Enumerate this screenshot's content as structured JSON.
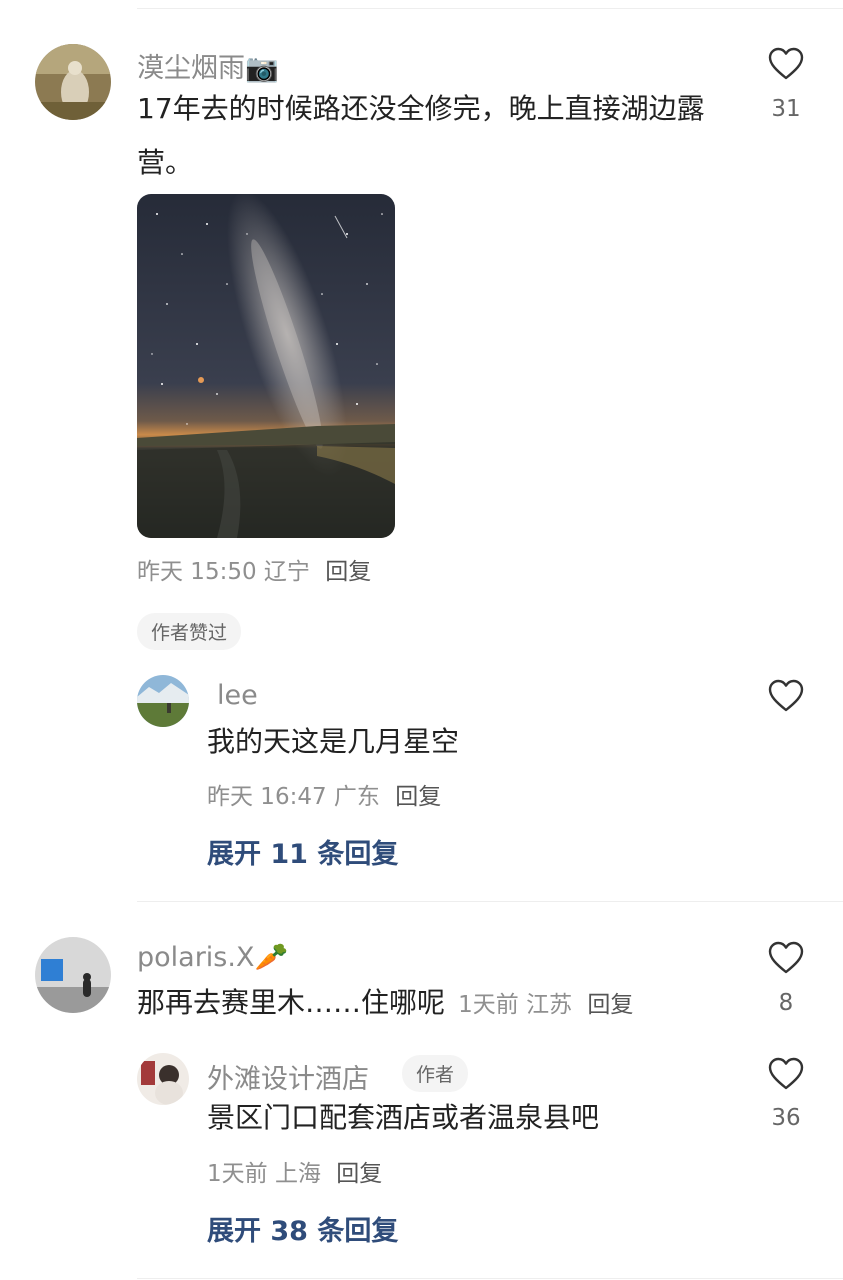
{
  "comments": [
    {
      "username": "漠尘烟雨📷",
      "text": "17年去的时候路还没全修完，晚上直接湖边露营。",
      "time": "昨天 15:50",
      "location": "辽宁",
      "reply_label": "回复",
      "likes": "31",
      "badge": "作者赞过",
      "reply": {
        "username": "lee",
        "text": "我的天这是几月星空",
        "time": "昨天 16:47",
        "location": "广东",
        "reply_label": "回复"
      },
      "expand_label": "展开 11 条回复"
    },
    {
      "username": "polaris.X🥕",
      "text": "那再去赛里木……住哪呢",
      "time": "1天前",
      "location": "江苏",
      "reply_label": "回复",
      "likes": "8",
      "reply": {
        "username": "外滩设计酒店",
        "author_tag": "作者",
        "text": "景区门口配套酒店或者温泉县吧",
        "time": "1天前",
        "location": "上海",
        "reply_label": "回复",
        "likes": "36"
      },
      "expand_label": "展开 38 条回复"
    }
  ],
  "colors": {
    "link": "#2f4c7a",
    "meta": "#8f8f8f",
    "name": "#8a8a8a"
  }
}
